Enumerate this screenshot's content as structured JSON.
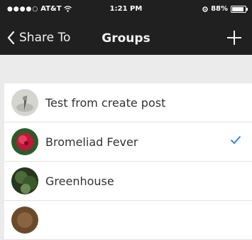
{
  "status_bar": {
    "carrier": "AT&T",
    "time": "1:21 PM",
    "battery": "88%",
    "battery_level": 0.88
  },
  "nav": {
    "back_label": "Share To",
    "title": "Groups"
  },
  "groups": [
    {
      "name": "Test from create post",
      "selected": false
    },
    {
      "name": "Bromeliad Fever",
      "selected": true
    },
    {
      "name": "Greenhouse",
      "selected": false
    }
  ],
  "colors": {
    "topbar": "#202020",
    "check": "#2a7de1",
    "background": "#ebebeb"
  }
}
